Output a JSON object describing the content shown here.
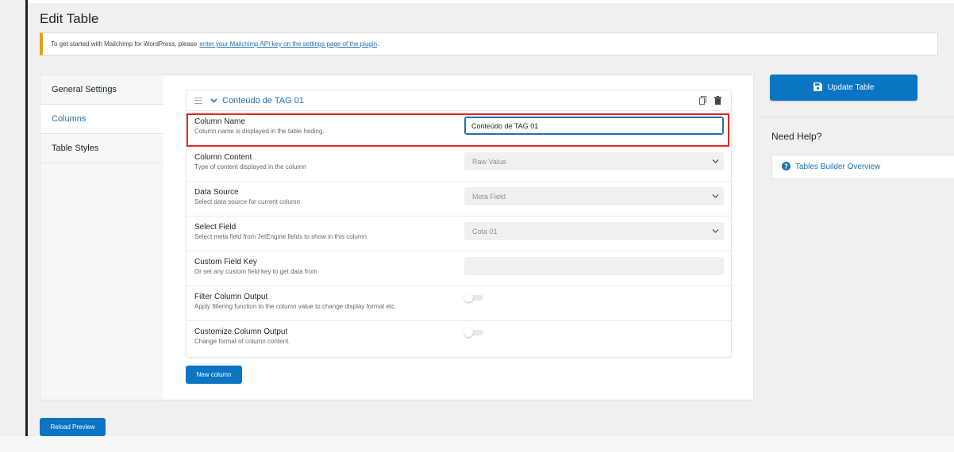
{
  "page": {
    "title": "Edit Table"
  },
  "notice": {
    "text": "To get started with Mailchimp for WordPress, please",
    "link_text": "enter your Mailchimp API key on the settings page of the plugin",
    "suffix": "."
  },
  "tabs": [
    {
      "label": "General Settings",
      "active": false
    },
    {
      "label": "Columns",
      "active": true
    },
    {
      "label": "Table Styles",
      "active": false
    }
  ],
  "column": {
    "title": "Conteúdo de TAG 01",
    "rows": [
      {
        "label": "Column Name",
        "desc": "Column name is displayed in the table heding.",
        "type": "text",
        "value": "Conteúdo de TAG 01"
      },
      {
        "label": "Column Content",
        "desc": "Type of content displayed in the column",
        "type": "select",
        "value": "Raw Value"
      },
      {
        "label": "Data Source",
        "desc": "Select data source for current column",
        "type": "select",
        "value": "Meta Field"
      },
      {
        "label": "Select Field",
        "desc": "Select meta field from JetEngine fields to show in this column",
        "type": "select",
        "value": "Cota 01"
      },
      {
        "label": "Custom Field Key",
        "desc": "Or set any custom field key to get data from",
        "type": "text-empty",
        "value": ""
      },
      {
        "label": "Filter Column Output",
        "desc": "Apply filtering function to the column value to change display format etc.",
        "type": "toggle",
        "value": "off"
      },
      {
        "label": "Customize Column Output",
        "desc": "Change format of column content.",
        "type": "toggle",
        "value": "off"
      }
    ]
  },
  "buttons": {
    "new_column": "New column",
    "update_table": "Update Table",
    "reload_preview": "Reload Preview"
  },
  "sidebar": {
    "need_help": "Need Help?",
    "help_link": "Tables Builder Overview"
  },
  "colors": {
    "accent": "#0a75c2",
    "link": "#2271b1",
    "highlight": "#e02424",
    "notice_border": "#dba617"
  }
}
